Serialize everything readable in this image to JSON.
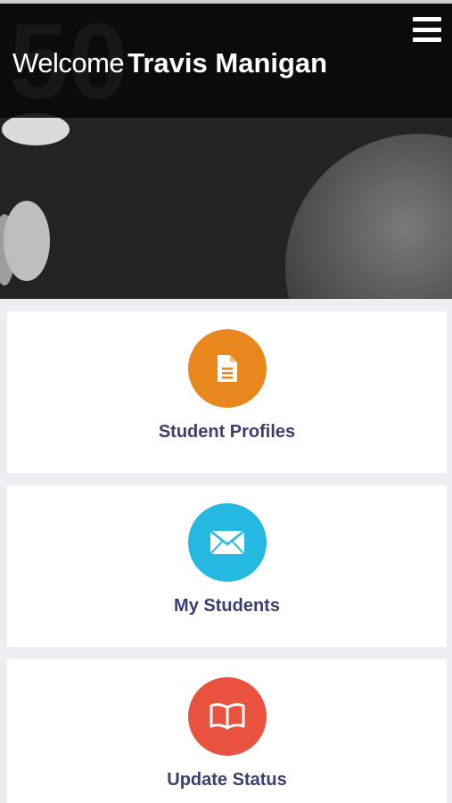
{
  "header": {
    "welcome_prefix": "Welcome",
    "user_name": "Travis Manigan"
  },
  "menu": {
    "icon": "hamburger-menu-icon"
  },
  "cards": [
    {
      "label": "Student Profiles",
      "icon": "document-icon",
      "color": "#e8871e"
    },
    {
      "label": "My Students",
      "icon": "envelope-icon",
      "color": "#25b8e0"
    },
    {
      "label": "Update Status",
      "icon": "open-book-icon",
      "color": "#e8523e"
    }
  ],
  "colors": {
    "label_text": "#3a3f6e",
    "card_background": "#ffffff",
    "page_background": "#eceef1"
  }
}
